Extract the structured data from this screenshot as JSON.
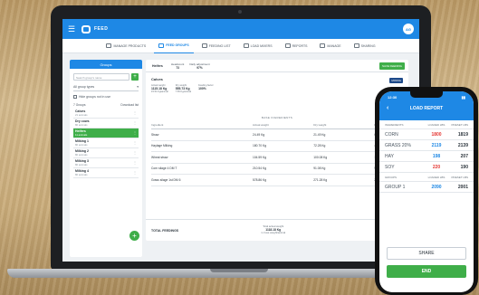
{
  "colors": {
    "brand_blue": "#1e88e5",
    "accent_green": "#3fae49",
    "red_value": "#e53935",
    "blue_value": "#1e88e5"
  },
  "app": {
    "title": "FEED",
    "avatar": "AG"
  },
  "tabs": [
    {
      "label": "MANAGE PRODUCTS",
      "icon": "products-icon",
      "active": false
    },
    {
      "label": "FEED GROUPS",
      "icon": "feed-groups-icon",
      "active": true
    },
    {
      "label": "FEEDING LIST",
      "icon": "list-icon",
      "active": false
    },
    {
      "label": "LOAD MIXERS",
      "icon": "truck-icon",
      "active": false
    },
    {
      "label": "REPORTS",
      "icon": "reports-icon",
      "active": false
    },
    {
      "label": "MANAGE",
      "icon": "manage-icon",
      "active": false
    },
    {
      "label": "SHARING",
      "icon": "share-icon",
      "active": false
    }
  ],
  "sidebar": {
    "header": "Groups",
    "search_placeholder": "Search group's name",
    "filter": "All group types",
    "hide_label": "Hide groups not in use",
    "count": "7 Groups",
    "download": "Download list",
    "items": [
      {
        "name": "Calves",
        "sub": "21 animals"
      },
      {
        "name": "Dry cows",
        "sub": "80 animals"
      },
      {
        "name": "Heifers",
        "sub": "11 animals",
        "selected": true
      },
      {
        "name": "Milking 1",
        "sub": "80 animals"
      },
      {
        "name": "Milking 2",
        "sub": "80 animals"
      },
      {
        "name": "Milking 3",
        "sub": "80 animals"
      },
      {
        "name": "Milking 4",
        "sub": "80 animals"
      }
    ]
  },
  "main": {
    "group": "Heifers",
    "headcount_label": "Headcount",
    "headcount": "73",
    "daily_label": "Daily adjustment",
    "daily": "97%",
    "save": "SAVE FEEDING",
    "ration_title": "Calves",
    "stats": [
      {
        "label": "Actual weight",
        "value": "1115.18 Kg",
        "sub": "15.54 Kg/animal"
      },
      {
        "label": "Dry weight",
        "value": "555.73 Kg",
        "sub": "7.65 Kg/animal"
      },
      {
        "label": "Feeding factor",
        "value": "100%",
        "sub": ""
      }
    ],
    "mix_badge": "MIXING",
    "mix_label": "Remove",
    "table_caption": "BASE INGREDIENTS",
    "columns": [
      "Ingredient",
      "Actual weight",
      "Dry weight",
      "Price"
    ],
    "rows": [
      [
        "Straw",
        "24.49 Kg",
        "21.49 Kg",
        "0.09 €"
      ],
      [
        "Haylage Milking",
        "180.70 Kg",
        "72.28 Kg",
        "4.5 €"
      ],
      [
        "Wheat straw",
        "104.59 Kg",
        "100.08 Kg",
        "14.97 €"
      ],
      [
        "Corn silage 4 DM T",
        "210.54 Kg",
        "91.08 Kg",
        "9.98 €"
      ],
      [
        "Grass silage 1st DM 6",
        "578.86 Kg",
        "271.28 Kg",
        "27.08 €"
      ]
    ],
    "footer_title": "TOTAL FEEDINGS",
    "footer_values": [
      {
        "label": "Total actual weight",
        "value": "1118.18 Kg",
        "sub": "1 cross weight/animal"
      },
      {
        "label": "Total dry wall",
        "value": "555.70 Kg",
        "sub": "7.65 Kg/animal"
      }
    ]
  },
  "phone": {
    "time": "12:30",
    "title": "LOAD REPORT",
    "headers": [
      "INGREDIENTS",
      "LOADED LBS",
      "PRESET LBS"
    ],
    "rows": [
      {
        "name": "CORN",
        "loaded": "1800",
        "preset": "1819",
        "color": "red"
      },
      {
        "name": "GRASS 20%",
        "loaded": "2119",
        "preset": "2139",
        "color": "blue"
      },
      {
        "name": "HAY",
        "loaded": "198",
        "preset": "207",
        "color": "blue"
      },
      {
        "name": "SOY",
        "loaded": "220",
        "preset": "190",
        "color": "red"
      }
    ],
    "groups_headers": [
      "GROUPS",
      "LOADED LBS",
      "PRESET LBS"
    ],
    "groups": [
      {
        "name": "GROUP 1",
        "loaded": "2090",
        "preset": "2001",
        "color": "blue"
      }
    ],
    "share": "SHARE",
    "end": "END"
  }
}
